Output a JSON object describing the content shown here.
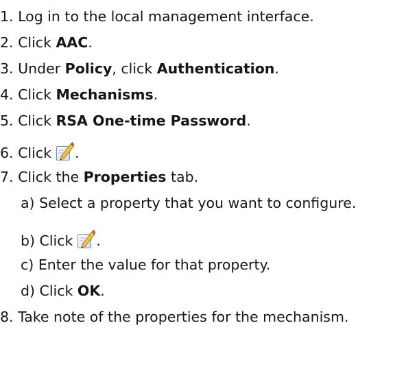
{
  "steps": [
    {
      "num": "1.",
      "pre": "Log in to the local management interface."
    },
    {
      "num": "2.",
      "pre": "Click ",
      "bold": "AAC",
      "post": "."
    },
    {
      "num": "3.",
      "pre": "Under ",
      "bold": "Policy",
      "mid": ", click ",
      "bold2": "Authentication",
      "post": "."
    },
    {
      "num": "4.",
      "pre": "Click ",
      "bold": "Mechanisms",
      "post": "."
    },
    {
      "num": "5.",
      "pre": "Click ",
      "bold": "RSA One-time Password",
      "post": "."
    },
    {
      "num": "6.",
      "pre": "Click",
      "icon": "edit-icon",
      "post": "."
    },
    {
      "num": "7.",
      "pre": "Click the ",
      "bold": "Properties",
      "post": " tab."
    },
    {
      "num": "8.",
      "pre": "Take note of the properties for the mechanism."
    }
  ],
  "substeps": [
    {
      "num": "a)",
      "pre": "Select a property that you want to configure."
    },
    {
      "num": "b)",
      "pre": "Click",
      "icon": "edit-icon",
      "post": "."
    },
    {
      "num": "c)",
      "pre": "Enter the value for that property."
    },
    {
      "num": "d)",
      "pre": "Click ",
      "bold": "OK",
      "post": "."
    }
  ]
}
